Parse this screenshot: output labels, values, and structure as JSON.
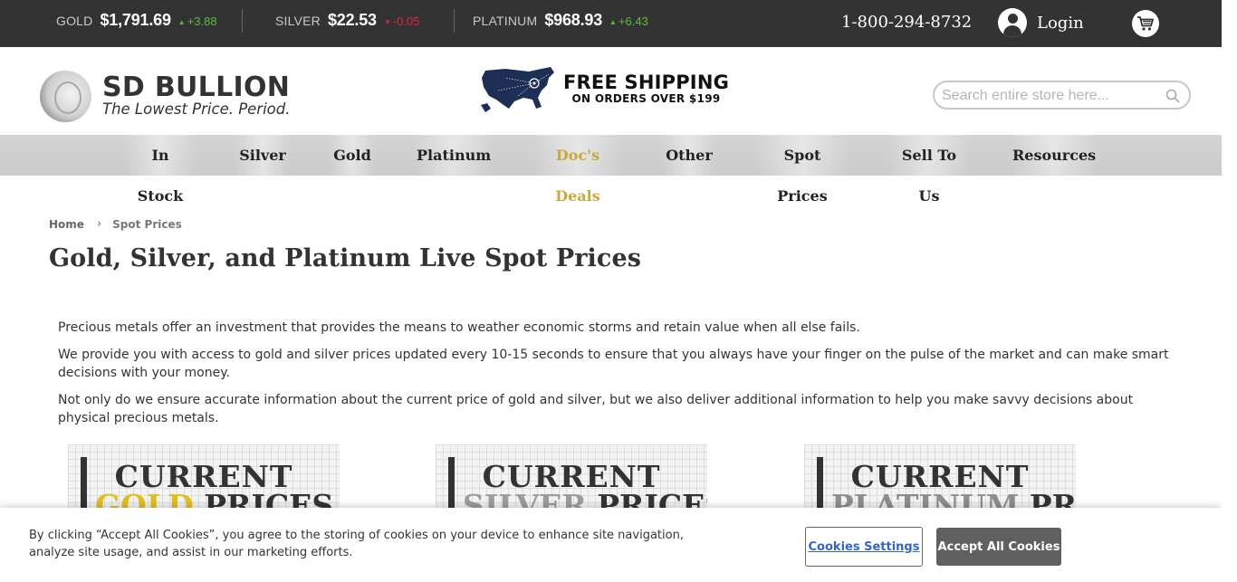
{
  "ticker": {
    "metals": [
      {
        "name": "GOLD",
        "price": "$1,791.69",
        "change": "+3.88",
        "direction": "up"
      },
      {
        "name": "SILVER",
        "price": "$22.53",
        "change": "-0.05",
        "direction": "down"
      },
      {
        "name": "PLATINUM",
        "price": "$968.93",
        "change": "+6.43",
        "direction": "up"
      }
    ],
    "phone": "1-800-294-8732",
    "login_label": "Login",
    "colors": {
      "bar_bg": "#333333",
      "up": "#5cbd3a",
      "down": "#e0263c"
    }
  },
  "header": {
    "logo_title": "SD BULLION",
    "logo_tagline": "The Lowest Price. Period.",
    "promo_big": "FREE SHIPPING",
    "promo_small": "ON ORDERS OVER $199",
    "search_placeholder": "Search entire store here..."
  },
  "nav": {
    "items": [
      "In Stock",
      "Silver",
      "Gold",
      "Platinum",
      "Doc's Deals",
      "Other",
      "Spot Prices",
      "Sell To Us",
      "Resources"
    ],
    "highlight_color": "#c9a93a"
  },
  "breadcrumb": {
    "home": "Home",
    "current": "Spot Prices"
  },
  "page": {
    "title": "Gold, Silver, and Platinum Live Spot Prices",
    "paragraphs": [
      "Precious metals offer an investment that provides the means to weather economic storms and retain value when all else fails.",
      "We provide you with access to gold and silver prices updated every 10-15 seconds to ensure that you always have your finger on the pulse of the market and can make smart decisions with your money.",
      "Not only do we ensure accurate information about the current price of gold and silver, but we also deliver additional information to help you make savvy decisions about physical precious metals."
    ]
  },
  "cards": [
    {
      "line1": "CURRENT",
      "metal": "GOLD",
      "line2_rest": " PRICES"
    },
    {
      "line1": "CURRENT",
      "metal": "SILVER",
      "line2_rest": " PRICES"
    },
    {
      "line1": "CURRENT",
      "metal": "PLATINUM",
      "line2_rest": " PRICES"
    }
  ],
  "cookie": {
    "text": "By clicking “Accept All Cookies”, you agree to the storing of cookies on your device to enhance site navigation, analyze site usage, and assist in our marketing efforts.",
    "settings_label": "Cookies Settings",
    "accept_label": "Accept All Cookies"
  }
}
